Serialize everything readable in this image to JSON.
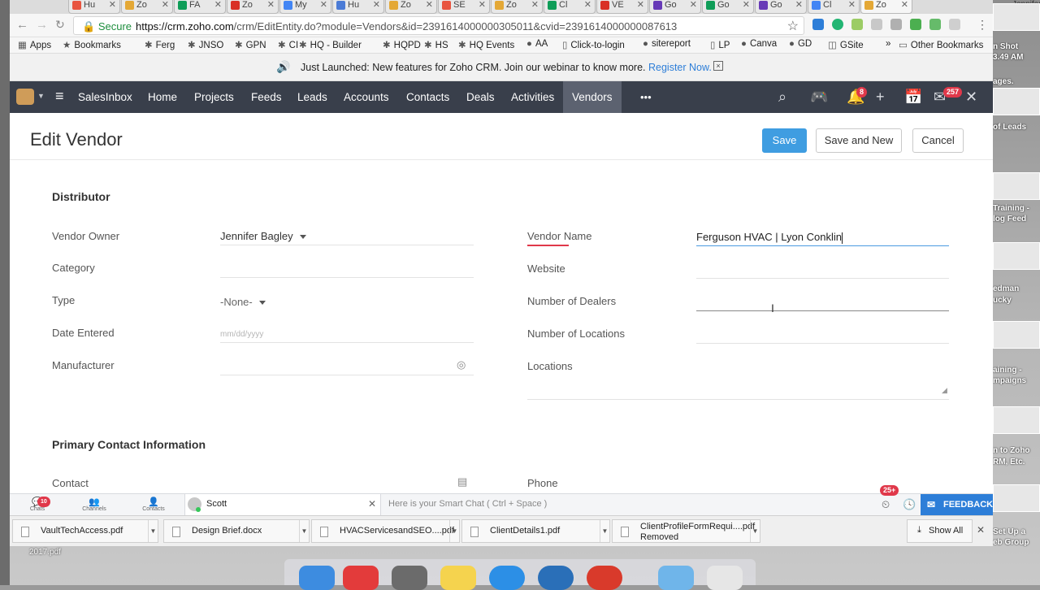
{
  "tabs": [
    {
      "label": "Hu",
      "color": "#e8543f"
    },
    {
      "label": "Zo",
      "color": "#e4a836"
    },
    {
      "label": "FA",
      "color": "#0f9d58"
    },
    {
      "label": "Zo",
      "color": "#d93025"
    },
    {
      "label": "My",
      "color": "#4285f4"
    },
    {
      "label": "Hu",
      "color": "#4b7bd6"
    },
    {
      "label": "Zo",
      "color": "#e4a836"
    },
    {
      "label": "SE",
      "color": "#e8543f"
    },
    {
      "label": "Zo",
      "color": "#e4a836"
    },
    {
      "label": "Cl",
      "color": "#0f9d58"
    },
    {
      "label": "VE",
      "color": "#d93025"
    },
    {
      "label": "Go",
      "color": "#673ab7"
    },
    {
      "label": "Go",
      "color": "#0f9d58"
    },
    {
      "label": "Go",
      "color": "#673ab7"
    },
    {
      "label": "Cl",
      "color": "#4285f4"
    },
    {
      "label": "Zo",
      "color": "#e4a836"
    }
  ],
  "address": {
    "secure": "Secure",
    "url_host": "https://crm.zoho.com",
    "url_path": "/crm/EditEntity.do?module=Vendors&id=2391614000000305011&cvid=2391614000000087613"
  },
  "bookmarks": [
    "Apps",
    "Bookmarks",
    "Ferg",
    "JNSO",
    "GPN",
    "CI",
    "HQ - Builder",
    "HQPD",
    "HS",
    "HQ Events",
    "AA",
    "Click-to-login",
    "sitereport",
    "LP",
    "Canva",
    "GD",
    "GSite"
  ],
  "bookmarks_more": "»",
  "bookmarks_other": "Other Bookmarks",
  "banner": {
    "text": "Just Launched: New features for Zoho CRM. Join our webinar to know more.",
    "link": "Register Now.",
    "close": "×"
  },
  "nav": {
    "items": [
      "SalesInbox",
      "Home",
      "Projects",
      "Feeds",
      "Leads",
      "Accounts",
      "Contacts",
      "Deals",
      "Activities",
      "Vendors"
    ],
    "more": "•••",
    "active": "Vendors",
    "notifications_count": "8",
    "mail_count": "257"
  },
  "page": {
    "title": "Edit Vendor",
    "save": "Save",
    "save_and_new": "Save and New",
    "cancel": "Cancel"
  },
  "sections": {
    "distributor": "Distributor",
    "primary_contact": "Primary Contact Information"
  },
  "left_fields": [
    {
      "label": "Vendor Owner",
      "value": "Jennifer Bagley"
    },
    {
      "label": "Category",
      "value": ""
    },
    {
      "label": "Type",
      "value": "-None-"
    },
    {
      "label": "Date Entered",
      "value": "mm/dd/yyyy"
    },
    {
      "label": "Manufacturer",
      "value": ""
    }
  ],
  "right_fields": [
    {
      "label": "Vendor Name",
      "value": "Ferguson HVAC | Lyon Conklin"
    },
    {
      "label": "Website",
      "value": ""
    },
    {
      "label": "Number of Dealers",
      "value": ""
    },
    {
      "label": "Number of Locations",
      "value": ""
    },
    {
      "label": "Locations",
      "value": ""
    }
  ],
  "contact_fields": [
    {
      "label": "Contact"
    },
    {
      "label": "Phone"
    }
  ],
  "chatbar": {
    "chats": "Chats",
    "chats_badge": "10",
    "channels": "Channels",
    "contacts": "Contacts",
    "active_chat": "Scott",
    "smart_chat_placeholder": "Here is your Smart Chat ( Ctrl + Space )",
    "notif_badge": "25+",
    "feedback": "FEEDBACK"
  },
  "downloads": [
    {
      "name": "VaultTechAccess.pdf",
      "sub": ""
    },
    {
      "name": "Design Brief.docx",
      "sub": ""
    },
    {
      "name": "HVACServicesandSEO....pdf",
      "sub": ""
    },
    {
      "name": "ClientDetails1.pdf",
      "sub": ""
    },
    {
      "name": "ClientProfileFormRequi....pdf",
      "sub": "Removed"
    }
  ],
  "downloads_show_all": "Show All",
  "desktop_right": [
    {
      "label": "n Shot",
      "sub": "3.49 AM"
    },
    {
      "label": "ages."
    },
    {
      "label": "of Leads"
    },
    {
      "label": "Training -",
      "sub": "log Feed"
    },
    {
      "label": "edman",
      "sub": "ucky"
    },
    {
      "label": "aining -",
      "sub": "mpaigns"
    },
    {
      "label": "n to Zoho",
      "sub": "RM, Etc."
    },
    {
      "label": "Set Up a",
      "sub": "eb Group"
    }
  ],
  "desktop_left_file": "2017.pdf",
  "user_name": "Jennifer"
}
